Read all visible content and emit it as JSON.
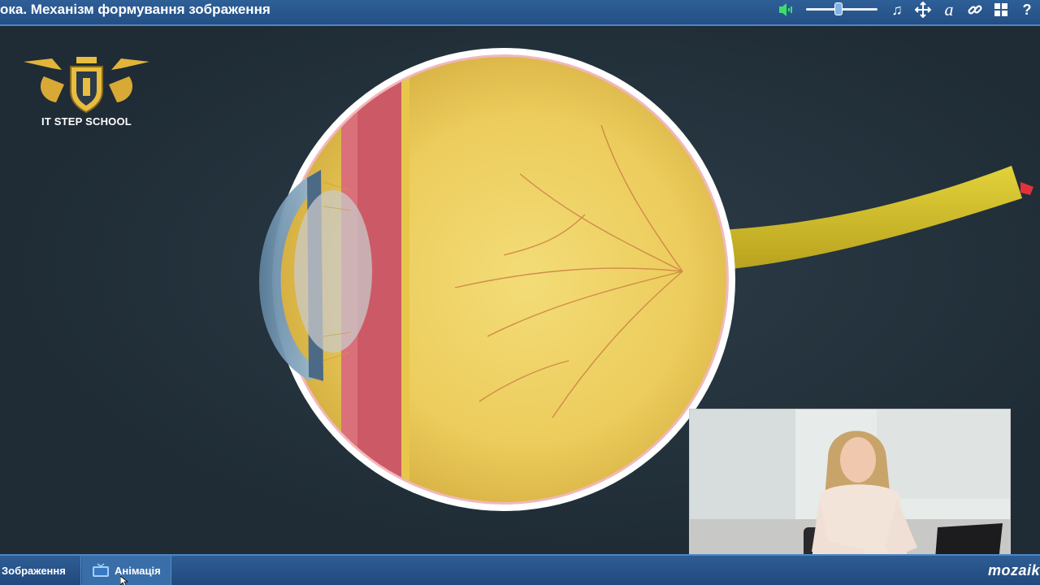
{
  "app": {
    "title": "ока. Механізм формування зображення",
    "brand": "mozaik"
  },
  "toolbar": {
    "icons": [
      "speaker-icon",
      "music-icon",
      "move-icon",
      "font-icon",
      "link-icon",
      "grid-icon",
      "help-icon"
    ],
    "volume_level": 0.45,
    "accent_color": "#2f5f96",
    "speaker_color": "#3adf6a"
  },
  "logo": {
    "text": "IT STEP SCHOOL"
  },
  "bottom_tabs": [
    {
      "label": "Зображення",
      "icon": "none"
    },
    {
      "label": "Анімація",
      "icon": "tv-icon"
    }
  ]
}
